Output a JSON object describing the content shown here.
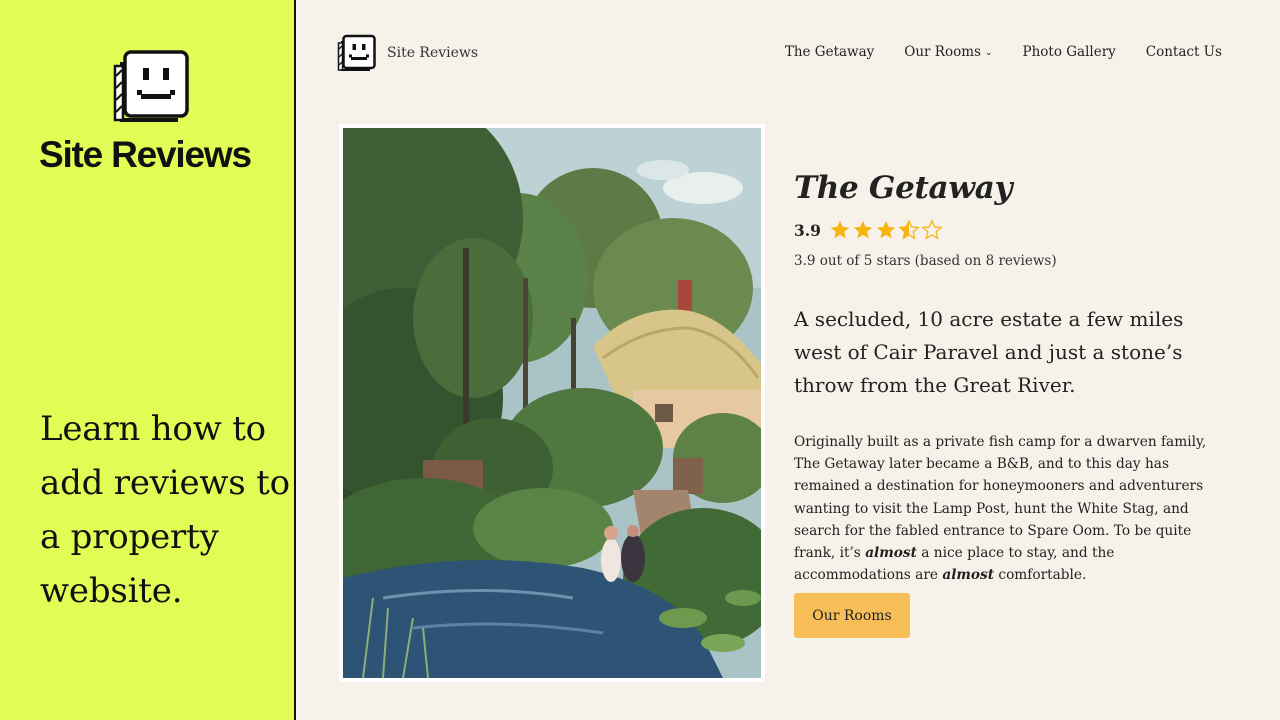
{
  "promo": {
    "brand": "Site Reviews",
    "tagline": "Learn how to add reviews to a property website.",
    "bg_color": "#e3fb55"
  },
  "header": {
    "site_name": "Site Reviews",
    "logo_icon": "smiley-face-icon",
    "nav": [
      {
        "label": "The Getaway"
      },
      {
        "label": "Our Rooms",
        "has_dropdown": true
      },
      {
        "label": "Photo Gallery"
      },
      {
        "label": "Contact Us"
      }
    ]
  },
  "property": {
    "title": "The Getaway",
    "rating": "3.9",
    "rating_value": 3.9,
    "rating_max": 5,
    "rating_summary": "3.9 out of 5 stars (based on 8 reviews)",
    "star_color": "#f6b40e",
    "lead": "A secluded, 10 acre estate a few miles west of Cair Paravel and just a stone’s throw from the Great River.",
    "body_1": "Originally built as a private fish camp for a dwarven family, The Getaway later became a B&B, and to this day has remained a destination for honeymooners and adventurers wanting to visit the Lamp Post, hunt the White Stag, and search for the fabled entrance to Spare Oom. To be quite frank, it’s ",
    "body_em_1": "almost",
    "body_2": " a nice place to stay, and the accommodations are ",
    "body_em_2": "almost",
    "body_3": " comfortable.",
    "cta_label": "Our Rooms",
    "cta_color": "#f7be58"
  }
}
